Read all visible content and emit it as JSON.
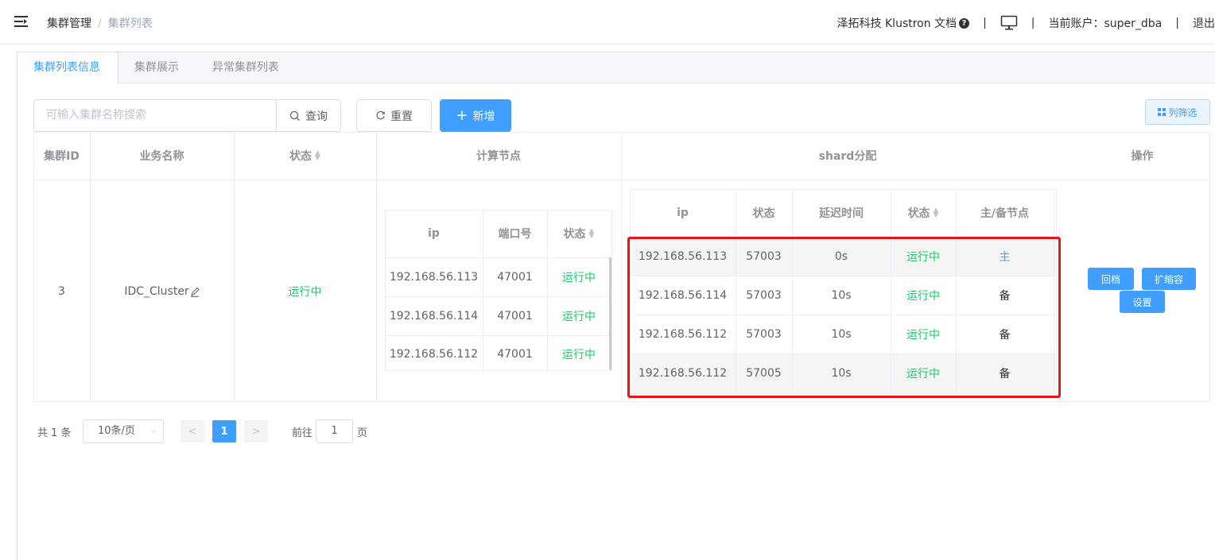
{
  "header": {
    "breadcrumb": [
      "集群管理",
      "集群列表"
    ],
    "company_doc": "泽拓科技 Klustron 文档",
    "account": "当前账户：super_dba",
    "logout": "退出",
    "separator": "|"
  },
  "tabs": [
    "集群列表信息",
    "集群展示",
    "异常集群列表"
  ],
  "toolbar": {
    "search_placeholder": "可输入集群名称搜索",
    "query": "查询",
    "reset": "重置",
    "add": "新增",
    "column_filter": "列筛选"
  },
  "table": {
    "headers": {
      "cluster_id": "集群ID",
      "name": "业务名称",
      "status": "状态",
      "compute": "计算节点",
      "shard": "shard分配",
      "ops": "操作"
    },
    "row": {
      "id": "3",
      "name": "IDC_Cluster",
      "status": "运行中"
    },
    "compute_headers": [
      "ip",
      "端口号",
      "状态"
    ],
    "compute_rows": [
      [
        "192.168.56.113",
        "47001",
        "运行中"
      ],
      [
        "192.168.56.114",
        "47001",
        "运行中"
      ],
      [
        "192.168.56.112",
        "47001",
        "运行中"
      ]
    ],
    "shard_headers": [
      "ip",
      "状态",
      "延迟时间",
      "状态",
      "主/备节点"
    ],
    "shard_rows": [
      [
        "192.168.56.113",
        "57003",
        "0s",
        "运行中",
        "主"
      ],
      [
        "192.168.56.114",
        "57003",
        "10s",
        "运行中",
        "备"
      ],
      [
        "192.168.56.112",
        "57003",
        "10s",
        "运行中",
        "备"
      ],
      [
        "192.168.56.112",
        "57005",
        "10s",
        "运行中",
        "备"
      ]
    ],
    "op_buttons": [
      "回档",
      "扩缩容",
      "设置"
    ]
  },
  "pagination": {
    "total": "共 1 条",
    "page_size": "10条/页",
    "current": "1",
    "goto_label": "前往",
    "goto_value": "1",
    "page_unit": "页"
  },
  "colors": {
    "primary": "#409eff",
    "running": "#13ce66",
    "highlight": "#e8141b"
  }
}
